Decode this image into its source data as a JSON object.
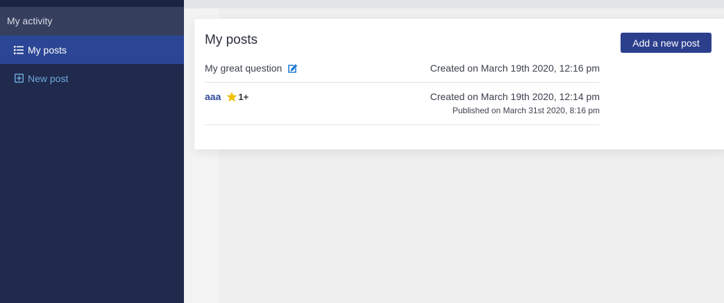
{
  "sidebar": {
    "section_label": "My activity",
    "items": [
      {
        "label": "My posts",
        "icon": "list-icon",
        "active": true
      },
      {
        "label": "New post",
        "icon": "plus-square-icon",
        "active": false
      }
    ]
  },
  "main": {
    "title": "My posts",
    "add_button_label": "Add a new post",
    "posts": [
      {
        "title": "My great question",
        "icon": "edit-icon",
        "created": "Created on March 19th 2020, 12:16 pm"
      },
      {
        "title": "aaa",
        "icon": "star-icon",
        "star_count": "1+",
        "created": "Created on March 19th 2020, 12:14 pm",
        "published": "Published on March 31st 2020, 8:16 pm"
      }
    ]
  },
  "colors": {
    "sidebar_bg": "#1f2a4c",
    "sidebar_active": "#2b4694",
    "sidebar_link": "#6fa8dc",
    "button_bg": "#2b3f8c",
    "star": "#f0c000",
    "edit_icon": "#1e7bd0"
  }
}
